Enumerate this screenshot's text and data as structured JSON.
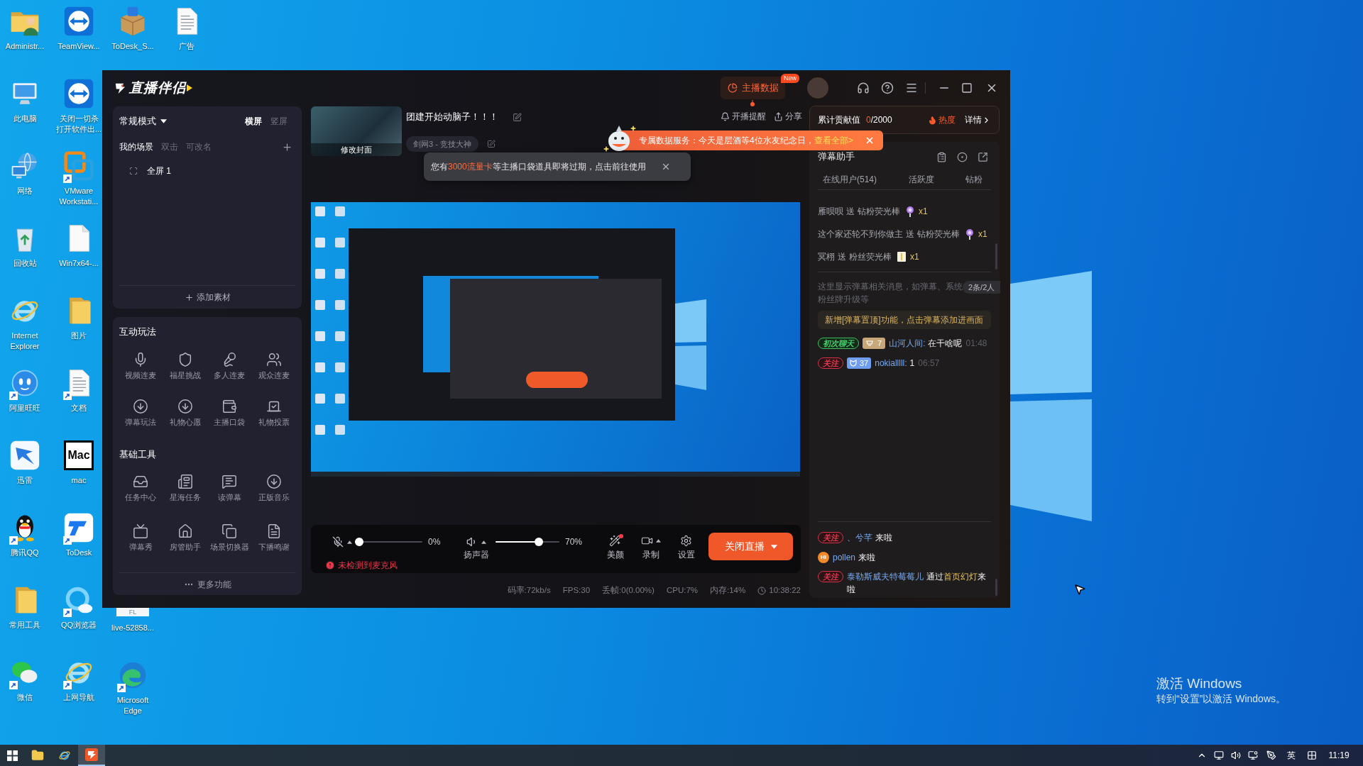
{
  "desktop": {
    "columns": [
      [
        {
          "label": "Administr...",
          "shortcut": false
        },
        {
          "label": "此电脑",
          "shortcut": false
        },
        {
          "label": "网络",
          "shortcut": false
        },
        {
          "label": "回收站",
          "shortcut": false
        },
        {
          "label": "Internet Explorer",
          "shortcut": false
        },
        {
          "label": "阿里旺旺",
          "shortcut": true
        },
        {
          "label": "迅雷",
          "shortcut": false
        },
        {
          "label": "腾讯QQ",
          "shortcut": true
        },
        {
          "label": "常用工具",
          "shortcut": false
        },
        {
          "label": "微信",
          "shortcut": true
        }
      ],
      [
        {
          "label": "TeamView...",
          "shortcut": false
        },
        {
          "label": "关闭一切杀打开软件出...",
          "shortcut": false
        },
        {
          "label": "VMware Workstati...",
          "shortcut": true
        },
        {
          "label": "Win7x64-...",
          "shortcut": false
        },
        {
          "label": "图片",
          "shortcut": false
        },
        {
          "label": "文档",
          "shortcut": true
        },
        {
          "label": "mac",
          "shortcut": false,
          "glyph": "Mac"
        },
        {
          "label": "ToDesk",
          "shortcut": true
        },
        {
          "label": "QQ浏览器",
          "shortcut": true
        },
        {
          "label": "上网导航",
          "shortcut": true
        }
      ],
      [
        {
          "label": "ToDesk_S...",
          "shortcut": false
        },
        {
          "label": "live-52858...",
          "shortcut": false,
          "glyph": "FL"
        },
        {
          "label": "Microsoft Edge",
          "shortcut": true
        }
      ],
      [
        {
          "label": "广告",
          "shortcut": false
        }
      ]
    ],
    "activation": {
      "title": "激活 Windows",
      "subtitle": "转到“设置”以激活 Windows。"
    }
  },
  "taskbar": {
    "apps": [
      {
        "selected": false
      },
      {
        "selected": false
      },
      {
        "selected": true
      }
    ],
    "ime": "英",
    "clock": "11:19"
  },
  "app": {
    "logo": "直播伴侣",
    "header": {
      "stats_button": "主播数据",
      "stats_badge": "New"
    },
    "scene_card": {
      "mode": "常规模式",
      "orientations": [
        {
          "label": "横屏",
          "selected": true
        },
        {
          "label": "竖屏",
          "selected": false
        }
      ],
      "scenes_title": "我的场景",
      "hints": [
        "双击",
        "可改名"
      ],
      "scenes": [
        {
          "label": "全屏 1"
        }
      ],
      "add_source": "添加素材"
    },
    "interactive": {
      "title": "互动玩法",
      "items": [
        "视频连麦",
        "福星挑战",
        "多人连麦",
        "观众连麦",
        "弹幕玩法",
        "礼物心愿",
        "主播口袋",
        "礼物投票"
      ]
    },
    "tools": {
      "title": "基础工具",
      "items": [
        "任务中心",
        "星海任务",
        "读弹幕",
        "正版音乐",
        "弹幕秀",
        "房管助手",
        "场景切换器",
        "下播鸣谢"
      ]
    },
    "more": "更多功能",
    "stream": {
      "cover_button": "修改封面",
      "title": "团建开始动脑子！！！",
      "category": "剑网3 - 竞技大神",
      "remind": "开播提醒",
      "share": "分享"
    },
    "banner": {
      "text": "专属数据服务：今天是层酒等4位水友纪念日，",
      "link": "查看全部>"
    },
    "toast": {
      "parts": [
        {
          "text": "您有",
          "highlight": false
        },
        {
          "text": "3000流量卡",
          "highlight": true
        },
        {
          "text": "等主播口袋道具即将过期，点击前往使用",
          "highlight": false
        }
      ]
    },
    "controls": {
      "mic": {
        "muted": true,
        "level": 0,
        "reading": "0%"
      },
      "speaker": {
        "label": "扬声器",
        "level": 0.7,
        "reading": "70%"
      },
      "warning": "未检测到麦克风",
      "tools": [
        {
          "label": "美颜",
          "dot": true,
          "caret": false
        },
        {
          "label": "录制",
          "dot": false,
          "caret": true
        },
        {
          "label": "设置",
          "dot": false,
          "caret": false
        }
      ],
      "live_button": "关闭直播"
    },
    "stats": [
      "码率:72kb/s",
      "FPS:30",
      "丢帧:0(0.00%)",
      "CPU:7%",
      "内存:14%"
    ],
    "duration": "10:38:22",
    "contribution": {
      "label": "累计贡献值",
      "current": "0",
      "total": "/2000",
      "heat": "热度",
      "details": "详情"
    },
    "danmu": {
      "title": "弹幕助手",
      "tabs": [
        "在线用户(514)",
        "活跃度",
        "钻粉"
      ],
      "gifts": [
        {
          "user": "雁呗呗",
          "verb": "送",
          "gift": "钻粉荧光棒",
          "kind": "diamond",
          "count": "x1"
        },
        {
          "user": "这个家还轮不到你做主",
          "verb": "送",
          "gift": "钻粉荧光棒",
          "kind": "diamond",
          "count": "x1"
        },
        {
          "user": "冥栩",
          "verb": "送",
          "gift": "粉丝荧光棒",
          "kind": "fan",
          "count": "x1"
        }
      ],
      "hint": [
        "这里显示弹幕相关消息，如弹幕、系统",
        "粉丝牌升级等"
      ],
      "counter": "2条/2人",
      "notice": "新增[弹幕置顶]功能，点击弹幕添加进画面",
      "messages": [
        {
          "badges": [
            {
              "kind": "first-chat",
              "text": "初次聊天"
            },
            {
              "kind": "fan",
              "text": "7"
            }
          ],
          "user": "山河人间:",
          "text": "在干啥呢",
          "time": "01:48"
        },
        {
          "badges": [
            {
              "kind": "follow",
              "text": "关注"
            },
            {
              "kind": "level",
              "text": "37"
            }
          ],
          "user": "nokialllll:",
          "text": "1",
          "time": "06:57"
        }
      ],
      "entries": [
        {
          "badge": {
            "kind": "follow",
            "text": "关注"
          },
          "parts": [
            {
              "text": "、兮芊",
              "kind": "user"
            },
            {
              "text": "来啦",
              "kind": "plain"
            }
          ]
        },
        {
          "badge": {
            "kind": "hi",
            "text": "Hi"
          },
          "parts": [
            {
              "text": "pollen",
              "kind": "user"
            },
            {
              "text": "来啦",
              "kind": "plain"
            }
          ]
        },
        {
          "badge": {
            "kind": "follow",
            "text": "关注"
          },
          "parts": [
            {
              "text": "泰勒斯威夫特莓莓儿",
              "kind": "user"
            },
            {
              "text": "通过",
              "kind": "plain"
            },
            {
              "text": "首页幻灯",
              "kind": "highlight"
            },
            {
              "text": "来啦",
              "kind": "plain"
            }
          ]
        }
      ]
    }
  }
}
